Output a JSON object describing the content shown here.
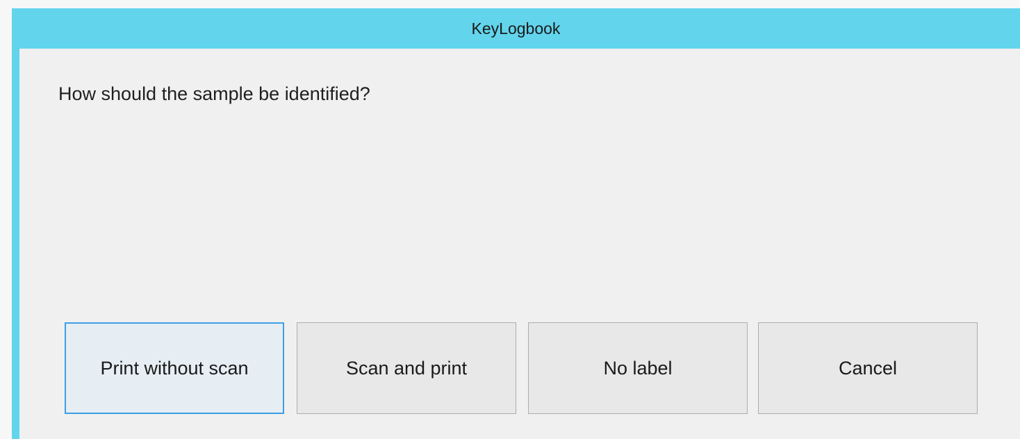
{
  "window": {
    "title": "KeyLogbook"
  },
  "dialog": {
    "prompt": "How should the sample be identified?",
    "buttons": {
      "print_without_scan": "Print without scan",
      "scan_and_print": "Scan and print",
      "no_label": "No label",
      "cancel": "Cancel"
    }
  },
  "colors": {
    "titlebar": "#62d4ec",
    "focus_border": "#3c9ee6"
  }
}
